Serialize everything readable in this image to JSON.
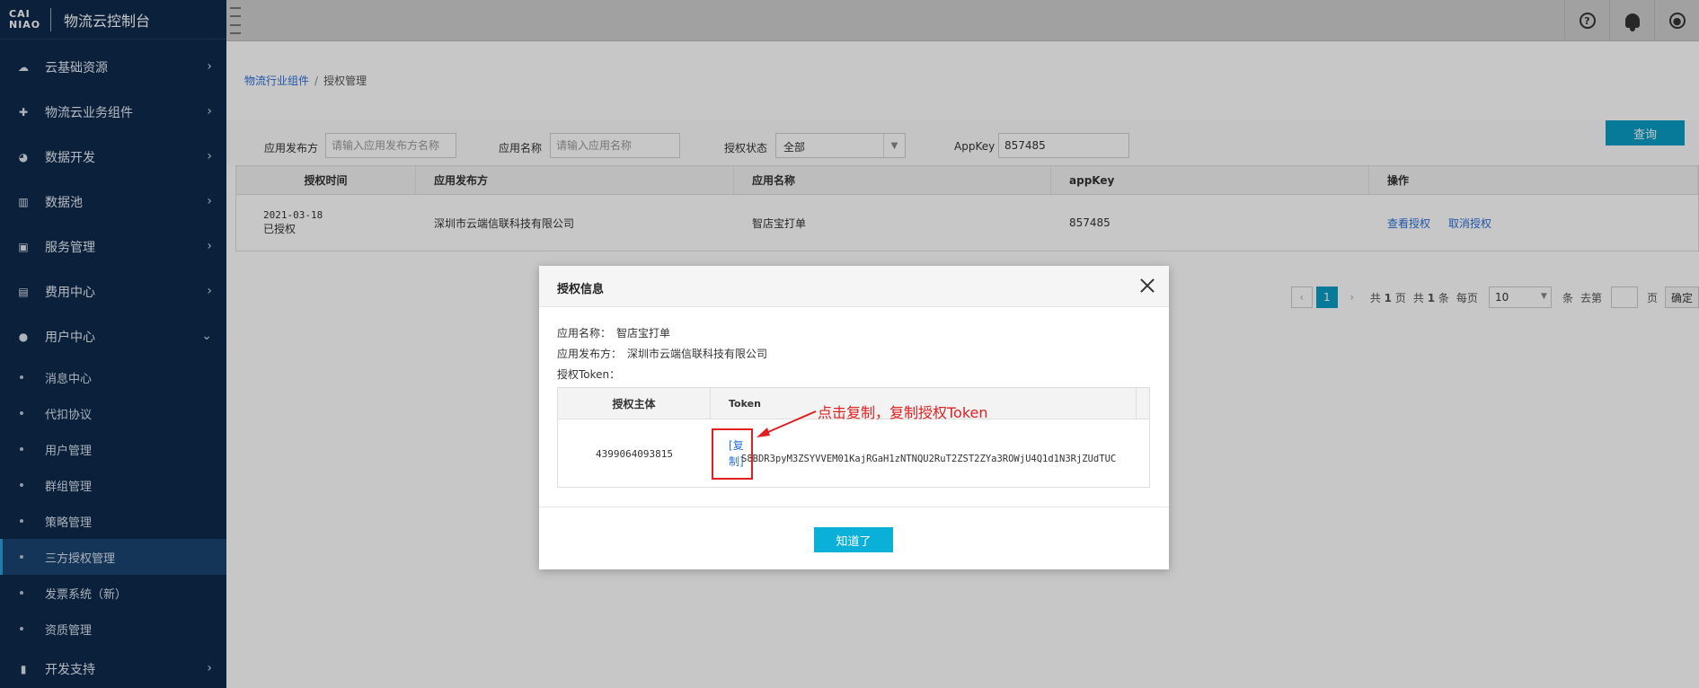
{
  "brand": {
    "logo_line1": "CAI",
    "logo_line2": "NIAO",
    "title": "物流云控制台"
  },
  "sidebar": {
    "items": [
      {
        "label": "云基础资源",
        "icon": "cloud-icon"
      },
      {
        "label": "物流云业务组件",
        "icon": "puzzle-icon"
      },
      {
        "label": "数据开发",
        "icon": "pie-chart-icon"
      },
      {
        "label": "数据池",
        "icon": "bar-chart-icon"
      },
      {
        "label": "服务管理",
        "icon": "service-icon"
      },
      {
        "label": "费用中心",
        "icon": "billing-icon"
      },
      {
        "label": "用户中心",
        "icon": "user-icon"
      }
    ],
    "subitems": [
      "消息中心",
      "代扣协议",
      "用户管理",
      "群组管理",
      "策略管理",
      "三方授权管理",
      "发票系统（新）",
      "资质管理"
    ],
    "last_item": {
      "label": "开发支持",
      "icon": "dev-support-icon"
    }
  },
  "breadcrumb": {
    "parent": "物流行业组件",
    "current": "授权管理"
  },
  "filters": {
    "publisher_label": "应用发布方",
    "publisher_placeholder": "请输入应用发布方名称",
    "appname_label": "应用名称",
    "appname_placeholder": "请输入应用名称",
    "status_label": "授权状态",
    "status_value": "全部",
    "appkey_label": "AppKey",
    "appkey_value": "857485",
    "query_button": "查询"
  },
  "table": {
    "headers": [
      "授权时间",
      "应用发布方",
      "应用名称",
      "appKey",
      "操作"
    ],
    "row": {
      "date": "2021-03-18",
      "status": "已授权",
      "publisher": "深圳市云端信联科技有限公司",
      "app_name": "智店宝打单",
      "appkey": "857485",
      "action_view": "查看授权",
      "action_cancel": "取消授权"
    }
  },
  "pager": {
    "current": "1",
    "total_pages_prefix": "共",
    "total_pages_value": "1",
    "total_pages_suffix": "页",
    "total_items_prefix": "共",
    "total_items_value": "1",
    "total_items_suffix": "条",
    "per_page_label": "每页",
    "per_page_value": "10",
    "per_page_unit": "条",
    "goto_label": "去第",
    "goto_unit": "页",
    "confirm": "确定"
  },
  "modal": {
    "title": "授权信息",
    "app_name_label": "应用名称：",
    "app_name_value": "智店宝打单",
    "publisher_label": "应用发布方：",
    "publisher_value": "深圳市云端信联科技有限公司",
    "token_label": "授权Token：",
    "token_table": {
      "header_subject": "授权主体",
      "header_token": "Token",
      "subject_value": "4399064093815",
      "copy_link": "[复制]",
      "token_value": "S8BDR3pyM3ZSYVVEM01KajRGaH1zNTNQU2RuT2ZST2ZYa3ROWjU4Q1d1N3RjZUdTUC"
    },
    "ok_button": "知道了"
  },
  "annotation": {
    "text": "点击复制，复制授权Token",
    "color": "#e02020"
  },
  "colors": {
    "sidebar_bg": "#0e2a4c",
    "accent": "#0a9bc4",
    "link": "#2a6fd8"
  }
}
